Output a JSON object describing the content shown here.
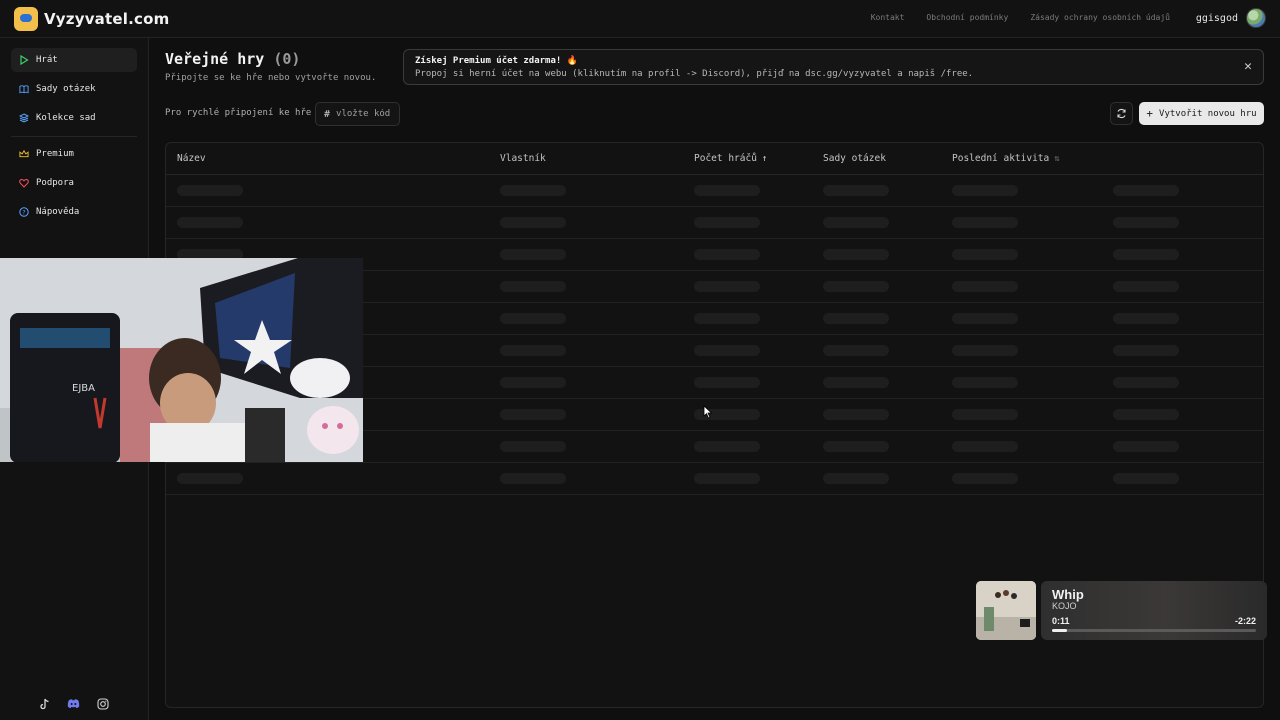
{
  "header": {
    "logo_text": "Vyzyvatel.com",
    "links": [
      "Kontakt",
      "Obchodní podmínky",
      "Zásady ochrany osobních údajů"
    ],
    "username": "ggisgod"
  },
  "sidebar": {
    "items": [
      {
        "label": "Hrát",
        "icon": "play-icon",
        "color": "#3ecf6a"
      },
      {
        "label": "Sady otázek",
        "icon": "book-icon",
        "color": "#5aa2ff"
      },
      {
        "label": "Kolekce sad",
        "icon": "layers-icon",
        "color": "#5aa2ff"
      },
      {
        "label": "Premium",
        "icon": "crown-icon",
        "color": "#f1c232"
      },
      {
        "label": "Podpora",
        "icon": "heart-icon",
        "color": "#ff4d5e"
      },
      {
        "label": "Nápověda",
        "icon": "help-circle-icon",
        "color": "#5aa2ff"
      }
    ],
    "social": [
      "tiktok-icon",
      "discord-icon",
      "instagram-icon"
    ]
  },
  "main": {
    "title": "Veřejné hry",
    "count": "(0)",
    "subtitle": "Připojte se ke hře nebo vytvořte novou.",
    "banner": {
      "title": "Získej Premium účet zdarma! 🔥",
      "text": "Propoj si herní účet na webu (kliknutím na profil -> Discord), přijď na dsc.gg/vyzyvatel a napiš /free."
    },
    "quick_join_label": "Pro rychlé připojení ke hře",
    "code_placeholder": "vložte kód",
    "create_label": "Vytvořit novou hru",
    "table": {
      "columns": [
        "Název",
        "Vlastník",
        "Počet hráčů",
        "Sady otázek",
        "Poslední aktivita"
      ],
      "sorted_column": "Počet hráčů",
      "placeholder_rows": 10
    }
  },
  "music": {
    "track": "Whip",
    "artist": "KOJO",
    "elapsed": "0:11",
    "remaining": "-2:22",
    "progress": 0.072
  },
  "colors": {
    "accent_create_bg": "#e9e9e9",
    "background": "#0f0f0f"
  }
}
